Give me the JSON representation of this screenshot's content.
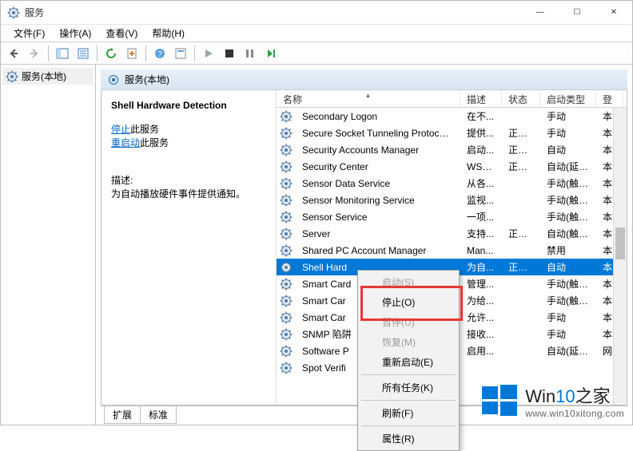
{
  "window": {
    "title": "服务",
    "controls": {
      "min": "—",
      "max": "☐",
      "close": "✕"
    }
  },
  "menubar": [
    "文件(F)",
    "操作(A)",
    "查看(V)",
    "帮助(H)"
  ],
  "tree": {
    "root": "服务(本地)"
  },
  "detail_header": "服务(本地)",
  "info": {
    "serviceName": "Shell Hardware Detection",
    "stopLabel": "停止",
    "stopSuffix": "此服务",
    "restartLabel": "重启动",
    "restartSuffix": "此服务",
    "descLabel": "描述:",
    "descText": "为自动播放硬件事件提供通知。"
  },
  "columns": {
    "name": "名称",
    "desc": "描述",
    "status": "状态",
    "start": "启动类型",
    "logon": "登"
  },
  "rows": [
    {
      "name": "Secondary Logon",
      "desc": "在不...",
      "status": "",
      "start": "手动",
      "logon": "本"
    },
    {
      "name": "Secure Socket Tunneling Protocol S...",
      "desc": "提供...",
      "status": "正在...",
      "start": "手动",
      "logon": "本"
    },
    {
      "name": "Security Accounts Manager",
      "desc": "启动...",
      "status": "正在...",
      "start": "自动",
      "logon": "本"
    },
    {
      "name": "Security Center",
      "desc": "WSC...",
      "status": "正在...",
      "start": "自动(延迟...",
      "logon": "本"
    },
    {
      "name": "Sensor Data Service",
      "desc": "从各...",
      "status": "",
      "start": "手动(触发...",
      "logon": "本"
    },
    {
      "name": "Sensor Monitoring Service",
      "desc": "监视...",
      "status": "",
      "start": "手动(触发...",
      "logon": "本"
    },
    {
      "name": "Sensor Service",
      "desc": "一项...",
      "status": "",
      "start": "手动(触发...",
      "logon": "本"
    },
    {
      "name": "Server",
      "desc": "支持...",
      "status": "正在...",
      "start": "自动(触发...",
      "logon": "本"
    },
    {
      "name": "Shared PC Account Manager",
      "desc": "Man...",
      "status": "",
      "start": "禁用",
      "logon": "本"
    },
    {
      "name": "Shell Hardware Detection",
      "desc": "为自...",
      "status": "正在...",
      "start": "自动",
      "logon": "本",
      "selected": true,
      "truncTo": "Shell Hard"
    },
    {
      "name": "Smart Card",
      "desc": "管理...",
      "status": "",
      "start": "手动(触发...",
      "logon": "本",
      "truncTo": "Smart Card"
    },
    {
      "name": "Smart Card Device Enumeration",
      "desc": "为给...",
      "status": "",
      "start": "手动(触发...",
      "logon": "本",
      "truncTo": "Smart Car"
    },
    {
      "name": "Smart Card Removal Policy",
      "desc": "允许...",
      "status": "",
      "start": "手动",
      "logon": "本",
      "truncTo": "Smart Car"
    },
    {
      "name": "SNMP 陷阱",
      "desc": "接收...",
      "status": "",
      "start": "手动",
      "logon": "本",
      "truncTo": "SNMP 陷阱"
    },
    {
      "name": "Software Protection",
      "desc": "启用...",
      "status": "",
      "start": "自动(延迟...",
      "logon": "网",
      "truncTo": "Software P"
    },
    {
      "name": "Spot Verifier",
      "desc": "",
      "status": "",
      "start": "",
      "logon": "",
      "truncTo": "Spot Verifi"
    }
  ],
  "tabs": {
    "extended": "扩展",
    "standard": "标准"
  },
  "contextMenu": {
    "start": "启动(S)",
    "stop": "停止(O)",
    "pause": "暂停(U)",
    "resume": "恢复(M)",
    "restart": "重新启动(E)",
    "allTasks": "所有任务(K)",
    "refresh": "刷新(F)",
    "properties": "属性(R)"
  },
  "watermark": {
    "brand_a": "Win",
    "brand_b": "10",
    "brand_c": "之家",
    "url": "www.win10xitong.com"
  }
}
